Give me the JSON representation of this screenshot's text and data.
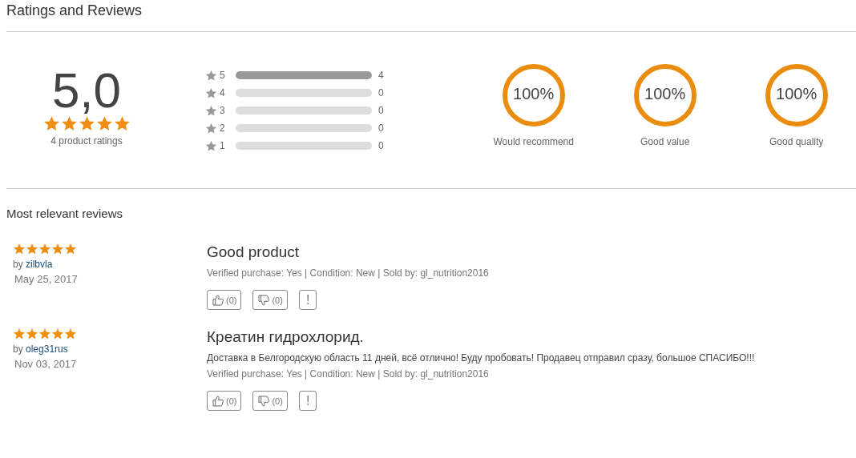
{
  "title": "Ratings and Reviews",
  "summary": {
    "average": "5,0",
    "stars": 5,
    "count_label": "4 product ratings"
  },
  "histogram": [
    {
      "star": "5",
      "level": 1,
      "count": "4"
    },
    {
      "star": "4",
      "level": 0,
      "count": "0"
    },
    {
      "star": "3",
      "level": 0,
      "count": "0"
    },
    {
      "star": "2",
      "level": 0,
      "count": "0"
    },
    {
      "star": "1",
      "level": 0,
      "count": "0"
    }
  ],
  "metrics": [
    {
      "value": "100%",
      "level": 1,
      "label": "Would recommend"
    },
    {
      "value": "100%",
      "level": 1,
      "label": "Good value"
    },
    {
      "value": "100%",
      "level": 1,
      "label": "Good quality"
    }
  ],
  "section_title": "Most relevant reviews",
  "reviews": [
    {
      "stars": 5,
      "by": "by",
      "author": "zilbvla",
      "date": "May 25, 2017",
      "title": "Good product",
      "meta": "Verified purchase: Yes | Condition: New | Sold by: gl_nutrition2016",
      "helpful": "(0)",
      "unhelpful": "(0)",
      "report": "!"
    },
    {
      "stars": 5,
      "by": "by",
      "author": "oleg31rus",
      "date": "Nov 03, 2017",
      "title": "Креатин гидрохлорид.",
      "body": "Доставка в Белгородскую область 11 дней, всё отлично! Буду пробовать! Продавец отправил сразу, большое СПАСИБО!!!",
      "meta": "Verified purchase: Yes | Condition: New | Sold by: gl_nutrition2016",
      "helpful": "(0)",
      "unhelpful": "(0)",
      "report": "!"
    }
  ]
}
